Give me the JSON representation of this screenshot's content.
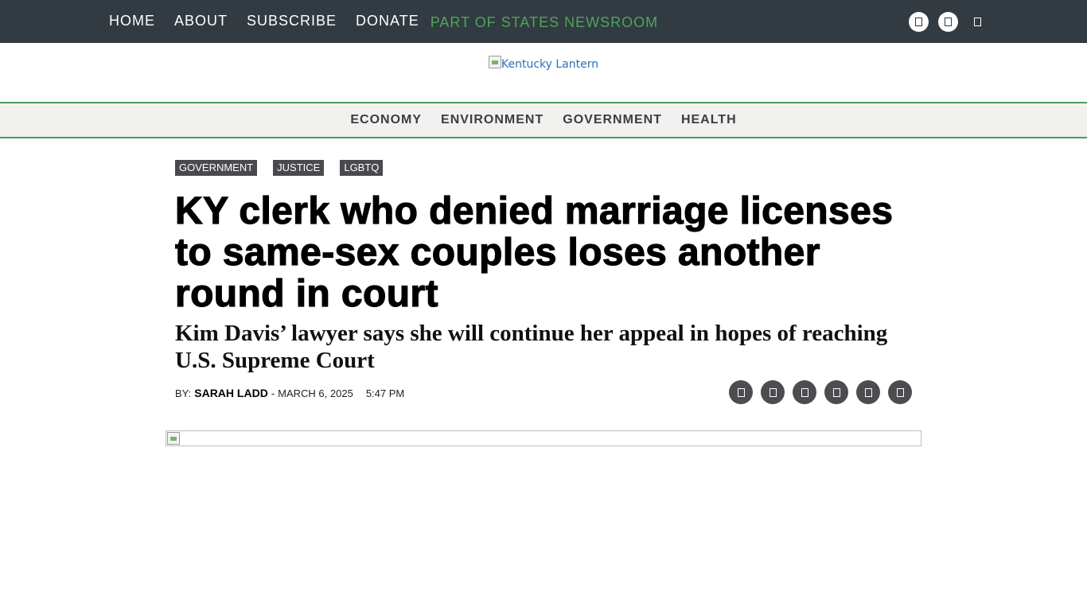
{
  "top_nav": {
    "items": [
      "HOME",
      "ABOUT",
      "SUBSCRIBE",
      "DONATE"
    ],
    "tagline": "PART OF STATES NEWSROOM",
    "tagline_color": "#4ea55a",
    "background": "#323a42",
    "icons": [
      "social-icon",
      "social-icon",
      "search-icon"
    ]
  },
  "logo": {
    "alt_text": "Kentucky Lantern"
  },
  "section_nav": {
    "items": [
      "ECONOMY",
      "ENVIRONMENT",
      "GOVERNMENT",
      "HEALTH"
    ],
    "accent": "#4e9a58"
  },
  "article": {
    "tags": [
      "GOVERNMENT",
      "JUSTICE",
      "LGBTQ"
    ],
    "headline": "KY clerk who denied marriage licenses to same-sex couples loses another round in court",
    "subheadline": "Kim Davis’ lawyer says she will continue her appeal in hopes of reaching U.S. Supreme Court",
    "byline_prefix": "BY:",
    "author": "SARAH LADD",
    "date_separator": "-",
    "date": "MARCH 6, 2025",
    "time": "5:47 PM",
    "share_icons": [
      "share-icon",
      "share-icon",
      "share-icon",
      "share-icon",
      "share-icon",
      "share-icon"
    ]
  }
}
